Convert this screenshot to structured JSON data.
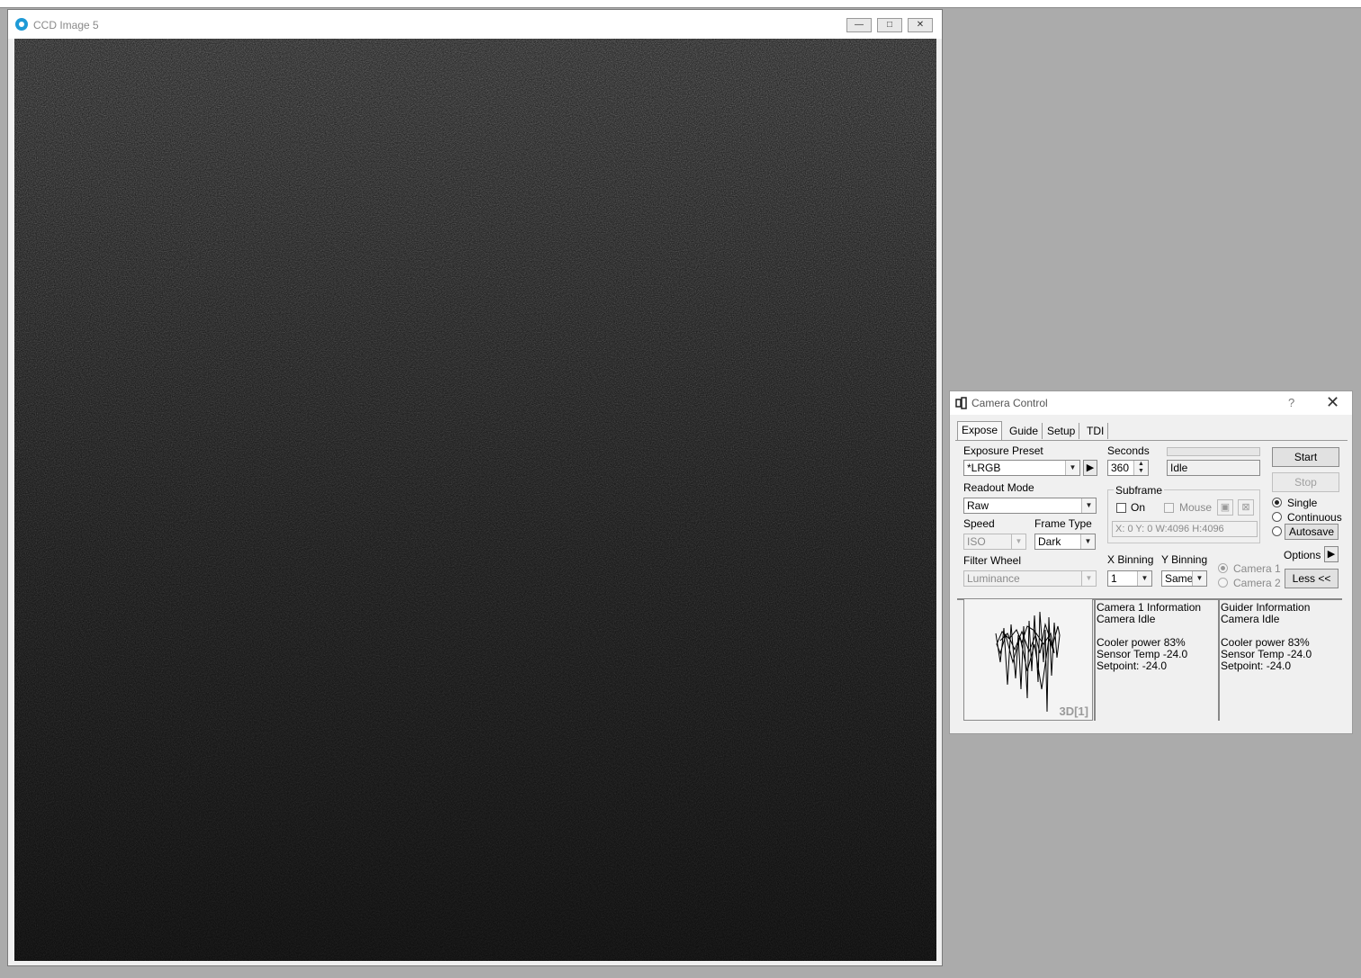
{
  "ccd_window": {
    "title": "CCD Image 5",
    "minimize_glyph": "—",
    "maximize_glyph": "□",
    "close_glyph": "✕"
  },
  "camera_control": {
    "title": "Camera Control",
    "help_glyph": "?",
    "close_glyph": "✕",
    "tabs": [
      {
        "label": "Expose",
        "active": true
      },
      {
        "label": "Guide",
        "active": false
      },
      {
        "label": "Setup",
        "active": false
      },
      {
        "label": "TDI",
        "active": false
      }
    ],
    "exposure_preset": {
      "label": "Exposure Preset",
      "value": "*LRGB"
    },
    "seconds": {
      "label": "Seconds",
      "value": "360"
    },
    "status": {
      "value": "Idle",
      "progress": 0
    },
    "readout_mode": {
      "label": "Readout Mode",
      "value": "Raw"
    },
    "subframe": {
      "label": "Subframe",
      "on_label": "On",
      "on_checked": false,
      "mouse_label": "Mouse",
      "mouse_checked": false,
      "coords": "X:    0 Y:    0 W:4096 H:4096"
    },
    "speed": {
      "label": "Speed",
      "value": "ISO"
    },
    "frame_type": {
      "label": "Frame Type",
      "value": "Dark"
    },
    "filter_wheel": {
      "label": "Filter Wheel",
      "value": "Luminance"
    },
    "x_binning": {
      "label": "X Binning",
      "value": "1"
    },
    "y_binning": {
      "label": "Y Binning",
      "value": "Same"
    },
    "camera_select": [
      {
        "label": "Camera 1",
        "selected": true
      },
      {
        "label": "Camera 2",
        "selected": false
      }
    ],
    "buttons": {
      "start": "Start",
      "stop": "Stop",
      "options": "Options",
      "less": "Less <<"
    },
    "mode": [
      {
        "label": "Single",
        "selected": true
      },
      {
        "label": "Continuous",
        "selected": false
      },
      {
        "label": "Autosave",
        "selected": false
      }
    ],
    "graph_label": "3D[1]",
    "camera1_info": {
      "title": "Camera 1 Information",
      "state": "Camera Idle",
      "cooler": "Cooler power 83%",
      "sensor": "Sensor Temp -24.0",
      "setpoint": "Setpoint: -24.0"
    },
    "guider_info": {
      "title": "Guider Information",
      "state": "Camera Idle",
      "cooler": "Cooler power 83%",
      "sensor": "Sensor Temp -24.0",
      "setpoint": "Setpoint: -24.0"
    },
    "colors": {
      "dialog_bg": "#f0f0f0",
      "desktop_bg": "#ababab",
      "image_dark": "#262626"
    }
  }
}
